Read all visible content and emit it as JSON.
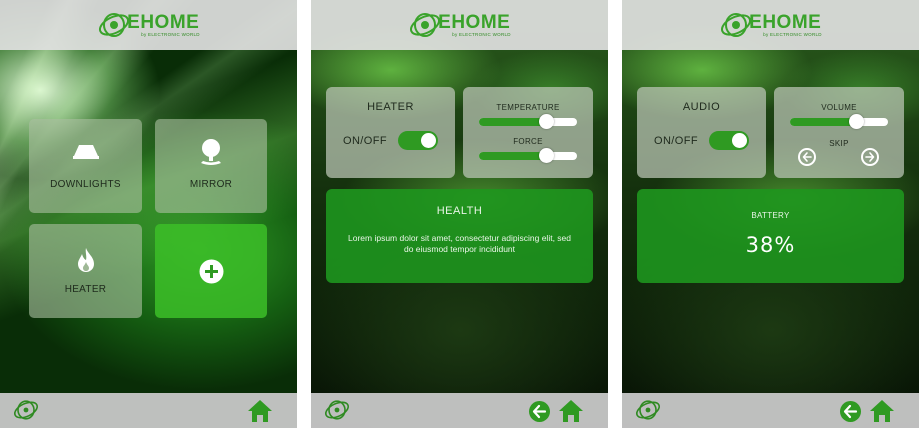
{
  "brand": {
    "name": "EHOME",
    "tagline": "by ELECTRONIC WORLD",
    "accent": "#3aa32b"
  },
  "screen1": {
    "tiles": [
      {
        "label": "DOWNLIGHTS",
        "icon": "downlight-icon"
      },
      {
        "label": "MIRROR",
        "icon": "mirror-icon"
      },
      {
        "label": "HEATER",
        "icon": "flame-icon"
      },
      {
        "label": "",
        "icon": "plus-icon"
      }
    ]
  },
  "screen2": {
    "control_panel": {
      "title": "HEATER",
      "toggle_label": "ON/OFF",
      "toggle_on": true
    },
    "slider_panel": {
      "sliders": [
        {
          "label": "TEMPERATURE",
          "value_percent": 68
        },
        {
          "label": "FORCE",
          "value_percent": 68
        }
      ]
    },
    "info_panel": {
      "title": "HEALTH",
      "body": "Lorem ipsum dolor sit amet, consectetur adipiscing elit, sed do eiusmod tempor incididunt"
    }
  },
  "screen3": {
    "control_panel": {
      "title": "AUDIO",
      "toggle_label": "ON/OFF",
      "toggle_on": true
    },
    "volume_panel": {
      "volume_label": "VOLUME",
      "volume_percent": 67,
      "skip_label": "SKIP"
    },
    "battery_panel": {
      "title": "BATTERY",
      "value": "38%"
    }
  },
  "nav": {
    "icons": [
      "ehome-logo-icon",
      "back-arrow-icon",
      "home-icon"
    ]
  }
}
